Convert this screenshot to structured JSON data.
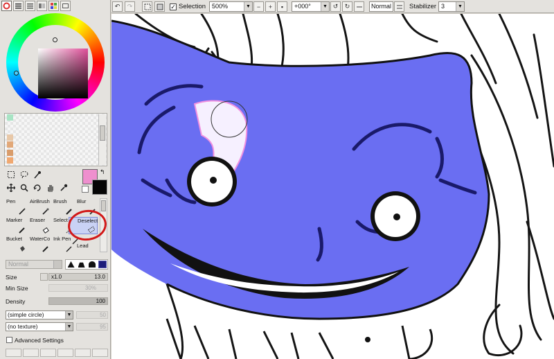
{
  "toolbar": {
    "selection_label": "Selection",
    "selection_checked": "✓",
    "zoom_value": "500%",
    "rotation_value": "+000°",
    "blend_mode": "Normal",
    "stabilizer_label": "Stabilizer",
    "stabilizer_value": "3"
  },
  "colors": {
    "foreground": "#ee8fce",
    "background": "#050505",
    "selection_fill": "#6a6ef2",
    "annotation": "#d21818"
  },
  "tools": [
    {
      "label": "Pen"
    },
    {
      "label": "AirBrush"
    },
    {
      "label": "Brush"
    },
    {
      "label": "Blur"
    },
    {
      "label": "Marker"
    },
    {
      "label": "Eraser"
    },
    {
      "label": "Select"
    },
    {
      "label": "Deselect"
    },
    {
      "label": "Bucket"
    },
    {
      "label": "WaterCo"
    },
    {
      "label": "Ink Pen"
    },
    {
      "label": "Lead"
    }
  ],
  "tool_settings": {
    "blend": "Normal",
    "size_label": "Size",
    "size_multiplier": "x1.0",
    "size_value": "13.0",
    "min_size_label": "Min Size",
    "min_size_value": "30%",
    "density_label": "Density",
    "density_value": "100",
    "shape": "(simple circle)",
    "shape_value": "50",
    "texture": "(no texture)",
    "texture_value": "95",
    "advanced_label": "Advanced Settings"
  }
}
